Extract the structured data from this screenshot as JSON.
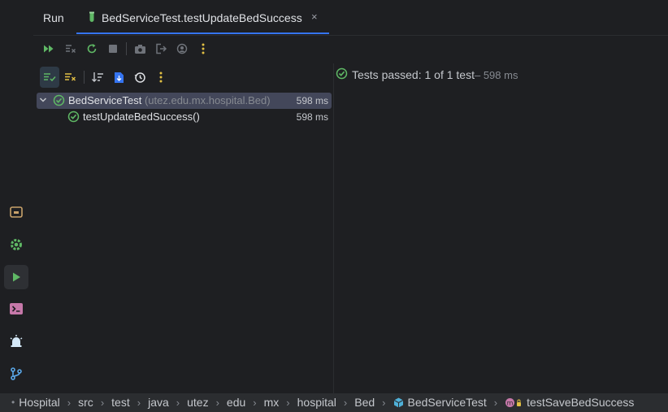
{
  "tabs": {
    "run_label": "Run",
    "test_tab_label": "BedServiceTest.testUpdateBedSuccess",
    "close_glyph": "×"
  },
  "toolbar": {
    "buttons": [
      "rerun-icon",
      "rerun-failed-icon",
      "restart-icon",
      "stop-icon",
      "screenshot-icon",
      "exit-icon",
      "coverage-icon",
      "more-icon"
    ]
  },
  "tree_toolbar": {
    "buttons": [
      "show-passed-icon",
      "show-ignored-icon",
      "sort-icon",
      "import-icon",
      "history-icon",
      "more-icon"
    ]
  },
  "tree": {
    "root": {
      "name": "BedServiceTest",
      "package": "(utez.edu.mx.hospital.Bed)",
      "time": "598 ms"
    },
    "children": [
      {
        "name": "testUpdateBedSuccess()",
        "time": "598 ms"
      }
    ]
  },
  "console": {
    "status_label": "Tests passed: 1 of 1 test",
    "status_duration": " – 598 ms"
  },
  "breadcrumb": {
    "items": [
      "Hospital",
      "src",
      "test",
      "java",
      "utez",
      "edu",
      "mx",
      "hospital",
      "Bed",
      "BedServiceTest",
      "testSaveBedSuccess"
    ]
  },
  "colors": {
    "accent": "#3574f0",
    "success": "#5fb865",
    "background": "#1e1f22"
  }
}
